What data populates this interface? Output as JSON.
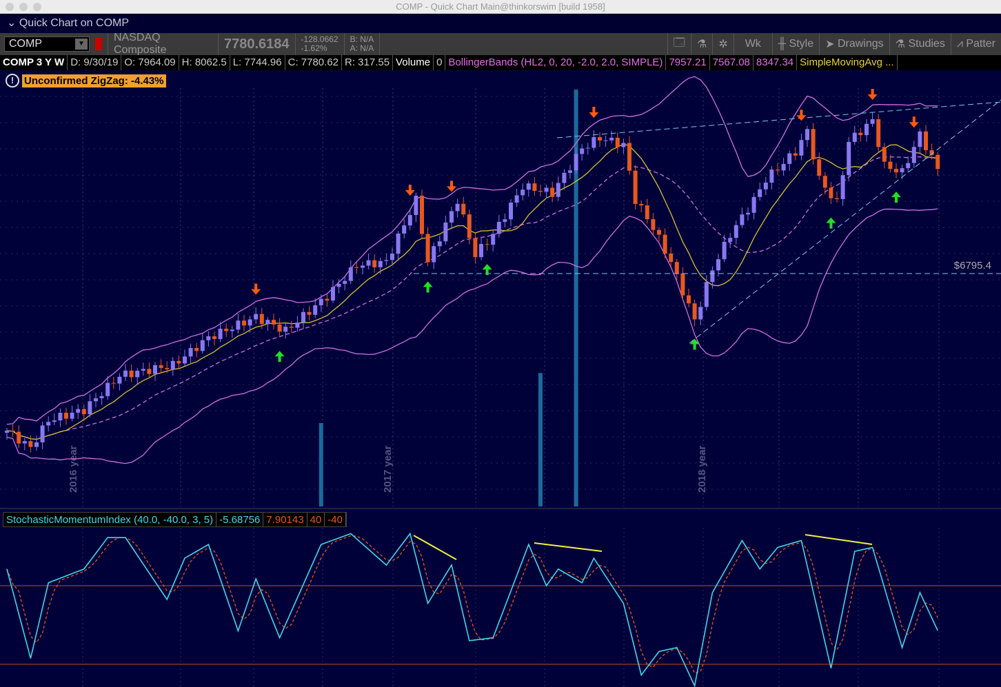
{
  "window": {
    "title": "COMP - Quick Chart Main@thinkorswim [build 1958]"
  },
  "header": {
    "quick_chart_label": "Quick Chart on COMP"
  },
  "toolbar": {
    "symbol": "COMP",
    "name": "NASDAQ Composite",
    "last": "7780.6184",
    "change": "-128.0662",
    "change_pct": "-1.62%",
    "bid": "B: N/A",
    "ask": "A: N/A",
    "aggregation": "Wk",
    "style": "Style",
    "drawings": "Drawings",
    "studies": "Studies",
    "patterns": "Patter"
  },
  "info": {
    "symbol_period": "COMP 3 Y W",
    "date": "D: 9/30/19",
    "open": "O: 7964.09",
    "high": "H: 8062.5",
    "low": "L: 7744.96",
    "close": "C: 7780.62",
    "range": "R: 317.55",
    "volume_label": "Volume",
    "volume_value": "0",
    "bb_label": "BollingerBands (HL2, 0, 20, -2.0, 2.0, SIMPLE)",
    "bb_mid": "7957.21",
    "bb_low": "7567.08",
    "bb_up": "8347.34",
    "sma_label": "SimpleMovingAvg ..."
  },
  "zigzag": {
    "label": "Unconfirmed ZigZag: -4.43%"
  },
  "price_line": {
    "label": "$6795.4",
    "value": 6795.4
  },
  "smi": {
    "label": "StochasticMomentumIndex (40.0, -40.0, 3, 5)",
    "smi": "-5.68756",
    "avg": "7.90143",
    "over_bought": "40",
    "over_sold": "-40"
  },
  "colors": {
    "up": "#8878f0",
    "down": "#e8581c",
    "bollinger": "#d070e0",
    "sma": "#d8c030",
    "smi": "#40d8e8",
    "smi_avg": "#e8581c",
    "volume": "#1a6a9a",
    "trend": "#80c8e8"
  },
  "chart_data": {
    "type": "candlestick",
    "year_labels": [
      {
        "week": 12,
        "label": "2016 year"
      },
      {
        "week": 65,
        "label": "2017 year"
      },
      {
        "week": 118,
        "label": "2018 year"
      }
    ],
    "price_path": [
      [
        0,
        5315
      ],
      [
        4,
        5153
      ],
      [
        7,
        5413
      ],
      [
        13,
        5510
      ],
      [
        19,
        5834
      ],
      [
        28,
        5932
      ],
      [
        34,
        6191
      ],
      [
        42,
        6386
      ],
      [
        47,
        6256
      ],
      [
        54,
        6581
      ],
      [
        59,
        6873
      ],
      [
        64,
        6905
      ],
      [
        69,
        7489
      ],
      [
        71,
        6905
      ],
      [
        76,
        7489
      ],
      [
        79,
        6970
      ],
      [
        82,
        7165
      ],
      [
        87,
        7619
      ],
      [
        92,
        7554
      ],
      [
        97,
        7976
      ],
      [
        100,
        8074
      ],
      [
        104,
        8009
      ],
      [
        106,
        7489
      ],
      [
        109,
        7230
      ],
      [
        112,
        6905
      ],
      [
        116,
        6354
      ],
      [
        119,
        6840
      ],
      [
        122,
        7165
      ],
      [
        126,
        7489
      ],
      [
        128,
        7684
      ],
      [
        133,
        7944
      ],
      [
        135,
        8138
      ],
      [
        137,
        7684
      ],
      [
        140,
        7457
      ],
      [
        142,
        8041
      ],
      [
        146,
        8236
      ],
      [
        148,
        7814
      ],
      [
        151,
        7749
      ],
      [
        154,
        8106
      ],
      [
        157,
        7781
      ]
    ],
    "smi_path": [
      [
        0,
        57
      ],
      [
        4,
        -34
      ],
      [
        7,
        43
      ],
      [
        13,
        57
      ],
      [
        17,
        89
      ],
      [
        20,
        89
      ],
      [
        27,
        26
      ],
      [
        30,
        68
      ],
      [
        34,
        82
      ],
      [
        39,
        -6
      ],
      [
        42,
        47
      ],
      [
        46,
        -13
      ],
      [
        53,
        82
      ],
      [
        58,
        93
      ],
      [
        64,
        61
      ],
      [
        68,
        93
      ],
      [
        71,
        22
      ],
      [
        75,
        61
      ],
      [
        78,
        -16
      ],
      [
        82,
        -13
      ],
      [
        88,
        82
      ],
      [
        91,
        40
      ],
      [
        93,
        57
      ],
      [
        97,
        43
      ],
      [
        99,
        68
      ],
      [
        104,
        22
      ],
      [
        107,
        -51
      ],
      [
        110,
        -27
      ],
      [
        113,
        -23
      ],
      [
        116,
        -62
      ],
      [
        119,
        33
      ],
      [
        124,
        86
      ],
      [
        127,
        57
      ],
      [
        130,
        79
      ],
      [
        134,
        86
      ],
      [
        139,
        -44
      ],
      [
        143,
        75
      ],
      [
        146,
        79
      ],
      [
        151,
        -23
      ],
      [
        154,
        33
      ],
      [
        157,
        -5.69
      ]
    ],
    "volume": [
      {
        "week": 53,
        "value": 1
      },
      {
        "week": 90,
        "value": 1.6
      },
      {
        "week": 96,
        "value": 5
      }
    ],
    "down_arrows": [
      42,
      68,
      75,
      99,
      134,
      146,
      153
    ],
    "up_arrows": [
      46,
      71,
      81,
      116,
      139,
      150
    ]
  }
}
